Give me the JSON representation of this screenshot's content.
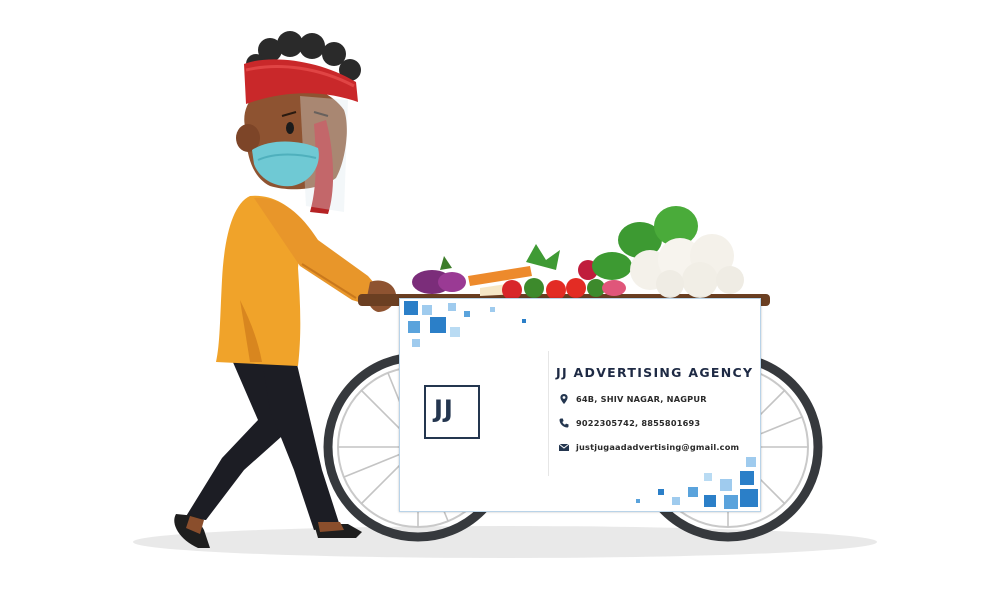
{
  "card": {
    "logo_text": "JJ",
    "agency_name": "JJ ADVERTISING AGENCY",
    "address": "64B, SHIV NAGAR, NAGPUR",
    "phone": "9022305742, 8855801693",
    "email": "justjugaadadvertising@gmail.com"
  },
  "icons": {
    "address": "location-pin-icon",
    "phone": "phone-icon",
    "email": "envelope-icon"
  },
  "colors": {
    "accent_blue": "#2b7fc8",
    "light_blue": "#9fcbee",
    "navy": "#24364f",
    "turban": "#c9282a",
    "shirt": "#f0a32a",
    "mask": "#6fc9d4",
    "wheel": "#36393d"
  }
}
